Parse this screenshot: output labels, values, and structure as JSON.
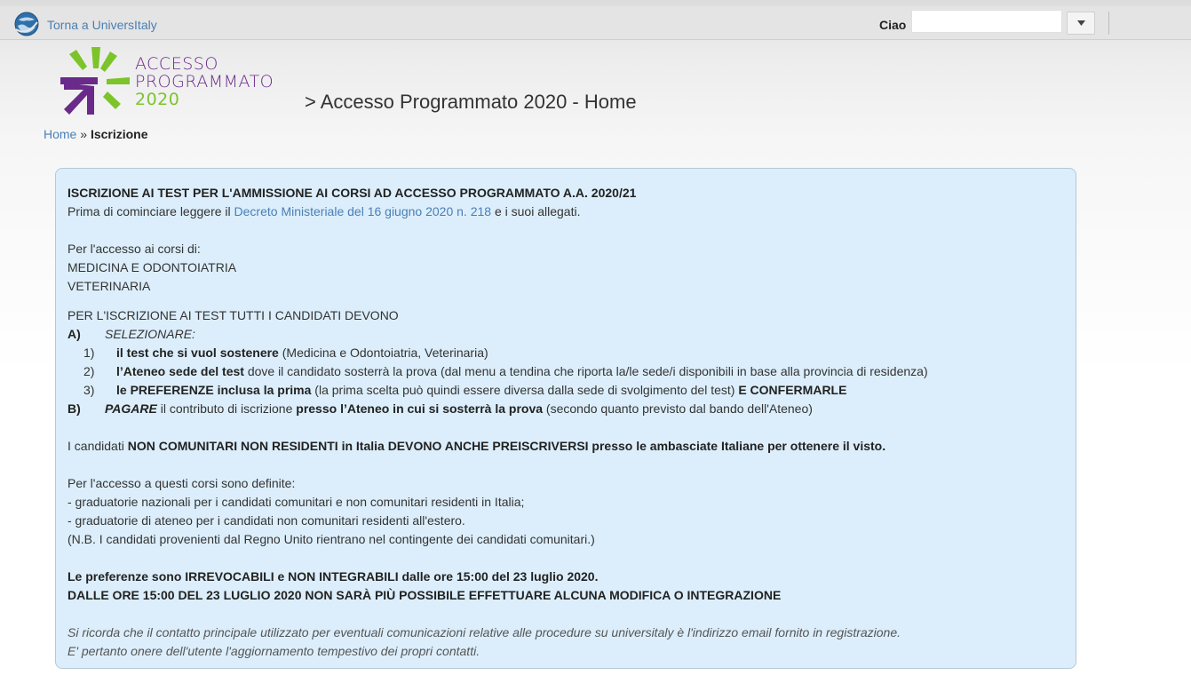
{
  "topbar": {
    "back_link": "Torna a UniversItaly",
    "greeting": "Ciao",
    "username_value": ""
  },
  "logo": {
    "line1": "ACCESSO",
    "line2": "PROGRAMMATO",
    "line3": "2020"
  },
  "page_title": "> Accesso Programmato 2020 - Home",
  "breadcrumb": {
    "home": "Home",
    "sep": " » ",
    "current": "Iscrizione"
  },
  "panel": {
    "heading": "ISCRIZIONE AI TEST PER L'AMMISSIONE AI CORSI AD ACCESSO PROGRAMMATO A.A. 2020/21",
    "intro_pre": "Prima di cominciare leggere il ",
    "intro_link": "Decreto Ministeriale del 16 giugno 2020 n. 218",
    "intro_post": " e i suoi allegati.",
    "courses_intro": "Per l'accesso ai corsi di:",
    "course1": "MEDICINA E ODONTOIATRIA",
    "course2": "VETERINARIA",
    "steps_intro": "PER L'ISCRIZIONE AI TEST TUTTI I CANDIDATI DEVONO",
    "a_label": "A)",
    "a_text": "SELEZIONARE:",
    "s1_num": "1)",
    "s1_bold": "il test che si vuol sostenere",
    "s1_rest": " (Medicina e Odontoiatria, Veterinaria)",
    "s2_num": "2)",
    "s2_bold": "l’Ateneo sede del test",
    "s2_rest": " dove il candidato sosterrà la prova (dal menu a tendina che riporta la/le sede/i disponibili in base alla provincia di residenza)",
    "s3_num": "3)",
    "s3_bold": "le PREFERENZE inclusa la prima",
    "s3_rest": " (la prima scelta può quindi essere diversa dalla sede di svolgimento del test) ",
    "s3_bold2": "E CONFERMARLE",
    "b_label": "B)",
    "b_italic": "PAGARE",
    "b_mid": " il contributo di iscrizione ",
    "b_bold": "presso l’Ateneo in cui si sosterrà la prova",
    "b_rest": " (secondo quanto previsto dal bando dell'Ateneo)",
    "noncom_pre": "I candidati ",
    "noncom_bold": "NON COMUNITARI NON RESIDENTI in Italia DEVONO ANCHE PREISCRIVERSI presso le ambasciate Italiane per ottenere il visto.",
    "rank_intro": "Per l'accesso a questi corsi sono definite:",
    "rank1": "- graduatorie nazionali per i candidati comunitari e non comunitari residenti in Italia;",
    "rank2": "- graduatorie di ateneo per i candidati non comunitari residenti all'estero.",
    "rank_nb": "(N.B. I candidati provenienti dal Regno Unito rientrano nel contingente dei candidati comunitari.)",
    "pref1": "Le preferenze sono IRREVOCABILI e NON INTEGRABILI dalle ore 15:00 del 23 luglio 2020.",
    "pref2": "DALLE ORE 15:00 DEL 23 LUGLIO 2020 NON SARÀ PIÙ POSSIBILE EFFETTUARE ALCUNA MODIFICA O INTEGRAZIONE",
    "note1": "Si ricorda che il contatto principale utilizzato per eventuali comunicazioni relative alle procedure su universitaly è l'indirizzo email fornito in registrazione.",
    "note2": "E' pertanto onere dell'utente l'aggiornamento tempestivo dei propri contatti."
  },
  "colors": {
    "link": "#4a7fb5",
    "panel_bg": "#dceefb",
    "logo_purple": "#6a2a8a",
    "logo_green": "#7cc42a"
  }
}
